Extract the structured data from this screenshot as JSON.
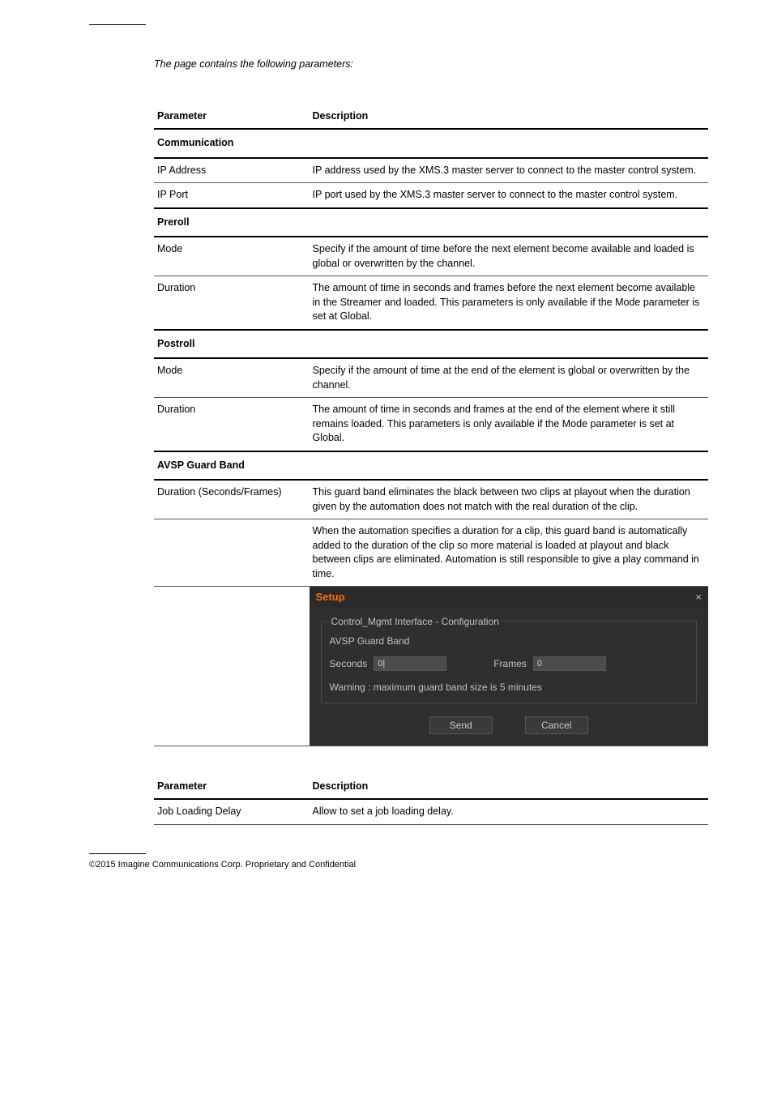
{
  "intro": "The page contains the following parameters:",
  "table1": {
    "headers": [
      "Parameter",
      "Description"
    ],
    "rows": [
      {
        "section": "Communication",
        "span": true
      },
      {
        "p": "IP Address",
        "d": "IP address used by the XMS.3 master server to connect to the master control system."
      },
      {
        "p": "IP Port",
        "d": "IP port used by the XMS.3 master server to connect to the master control system."
      },
      {
        "section": "Preroll",
        "span": true
      },
      {
        "p": "Mode",
        "d": "Specify if the amount of time before the next element become available and loaded is global or overwritten by the channel."
      },
      {
        "p": "Duration",
        "d": "The amount of time in seconds and frames before the next element become available in the Streamer and loaded. This parameters is only available if the Mode parameter is set at Global."
      },
      {
        "section": "Postroll",
        "span": true
      },
      {
        "p": "Mode",
        "d": "Specify if the amount of time at the end of the element is global or overwritten by the channel."
      },
      {
        "p": "Duration",
        "d": "The amount of time in seconds and frames at the end of the element where it still remains loaded. This parameters is only available if the Mode parameter is set at Global."
      },
      {
        "section": "AVSP Guard Band",
        "span": true
      },
      {
        "p": "Duration (Seconds/Frames)",
        "d": "This guard band eliminates the black between two clips at playout when the duration given by the automation does not match with the real duration of the clip."
      },
      {
        "p": "",
        "d": "When the automation specifies a duration for a clip, this guard band is automatically added to the duration of the clip so more material is loaded at playout and black between clips are eliminated. Automation is still responsible to give a play command in time."
      }
    ]
  },
  "dialog": {
    "title": "Setup",
    "legend": "Control_Mgmt Interface - Configuration",
    "sub": "AVSP Guard Band",
    "labels": {
      "seconds": "Seconds",
      "frames": "Frames"
    },
    "values": {
      "seconds": "0|",
      "frames": "0"
    },
    "warning": "Warning : maximum guard band size is 5 minutes",
    "buttons": {
      "send": "Send",
      "cancel": "Cancel"
    }
  },
  "table2": {
    "headers": [
      "Parameter",
      "Description"
    ],
    "rows": [
      {
        "p": "Job Loading Delay",
        "d": "Allow to set a job loading delay."
      }
    ]
  },
  "footer": "©2015 Imagine Communications Corp. Proprietary and Confidential"
}
